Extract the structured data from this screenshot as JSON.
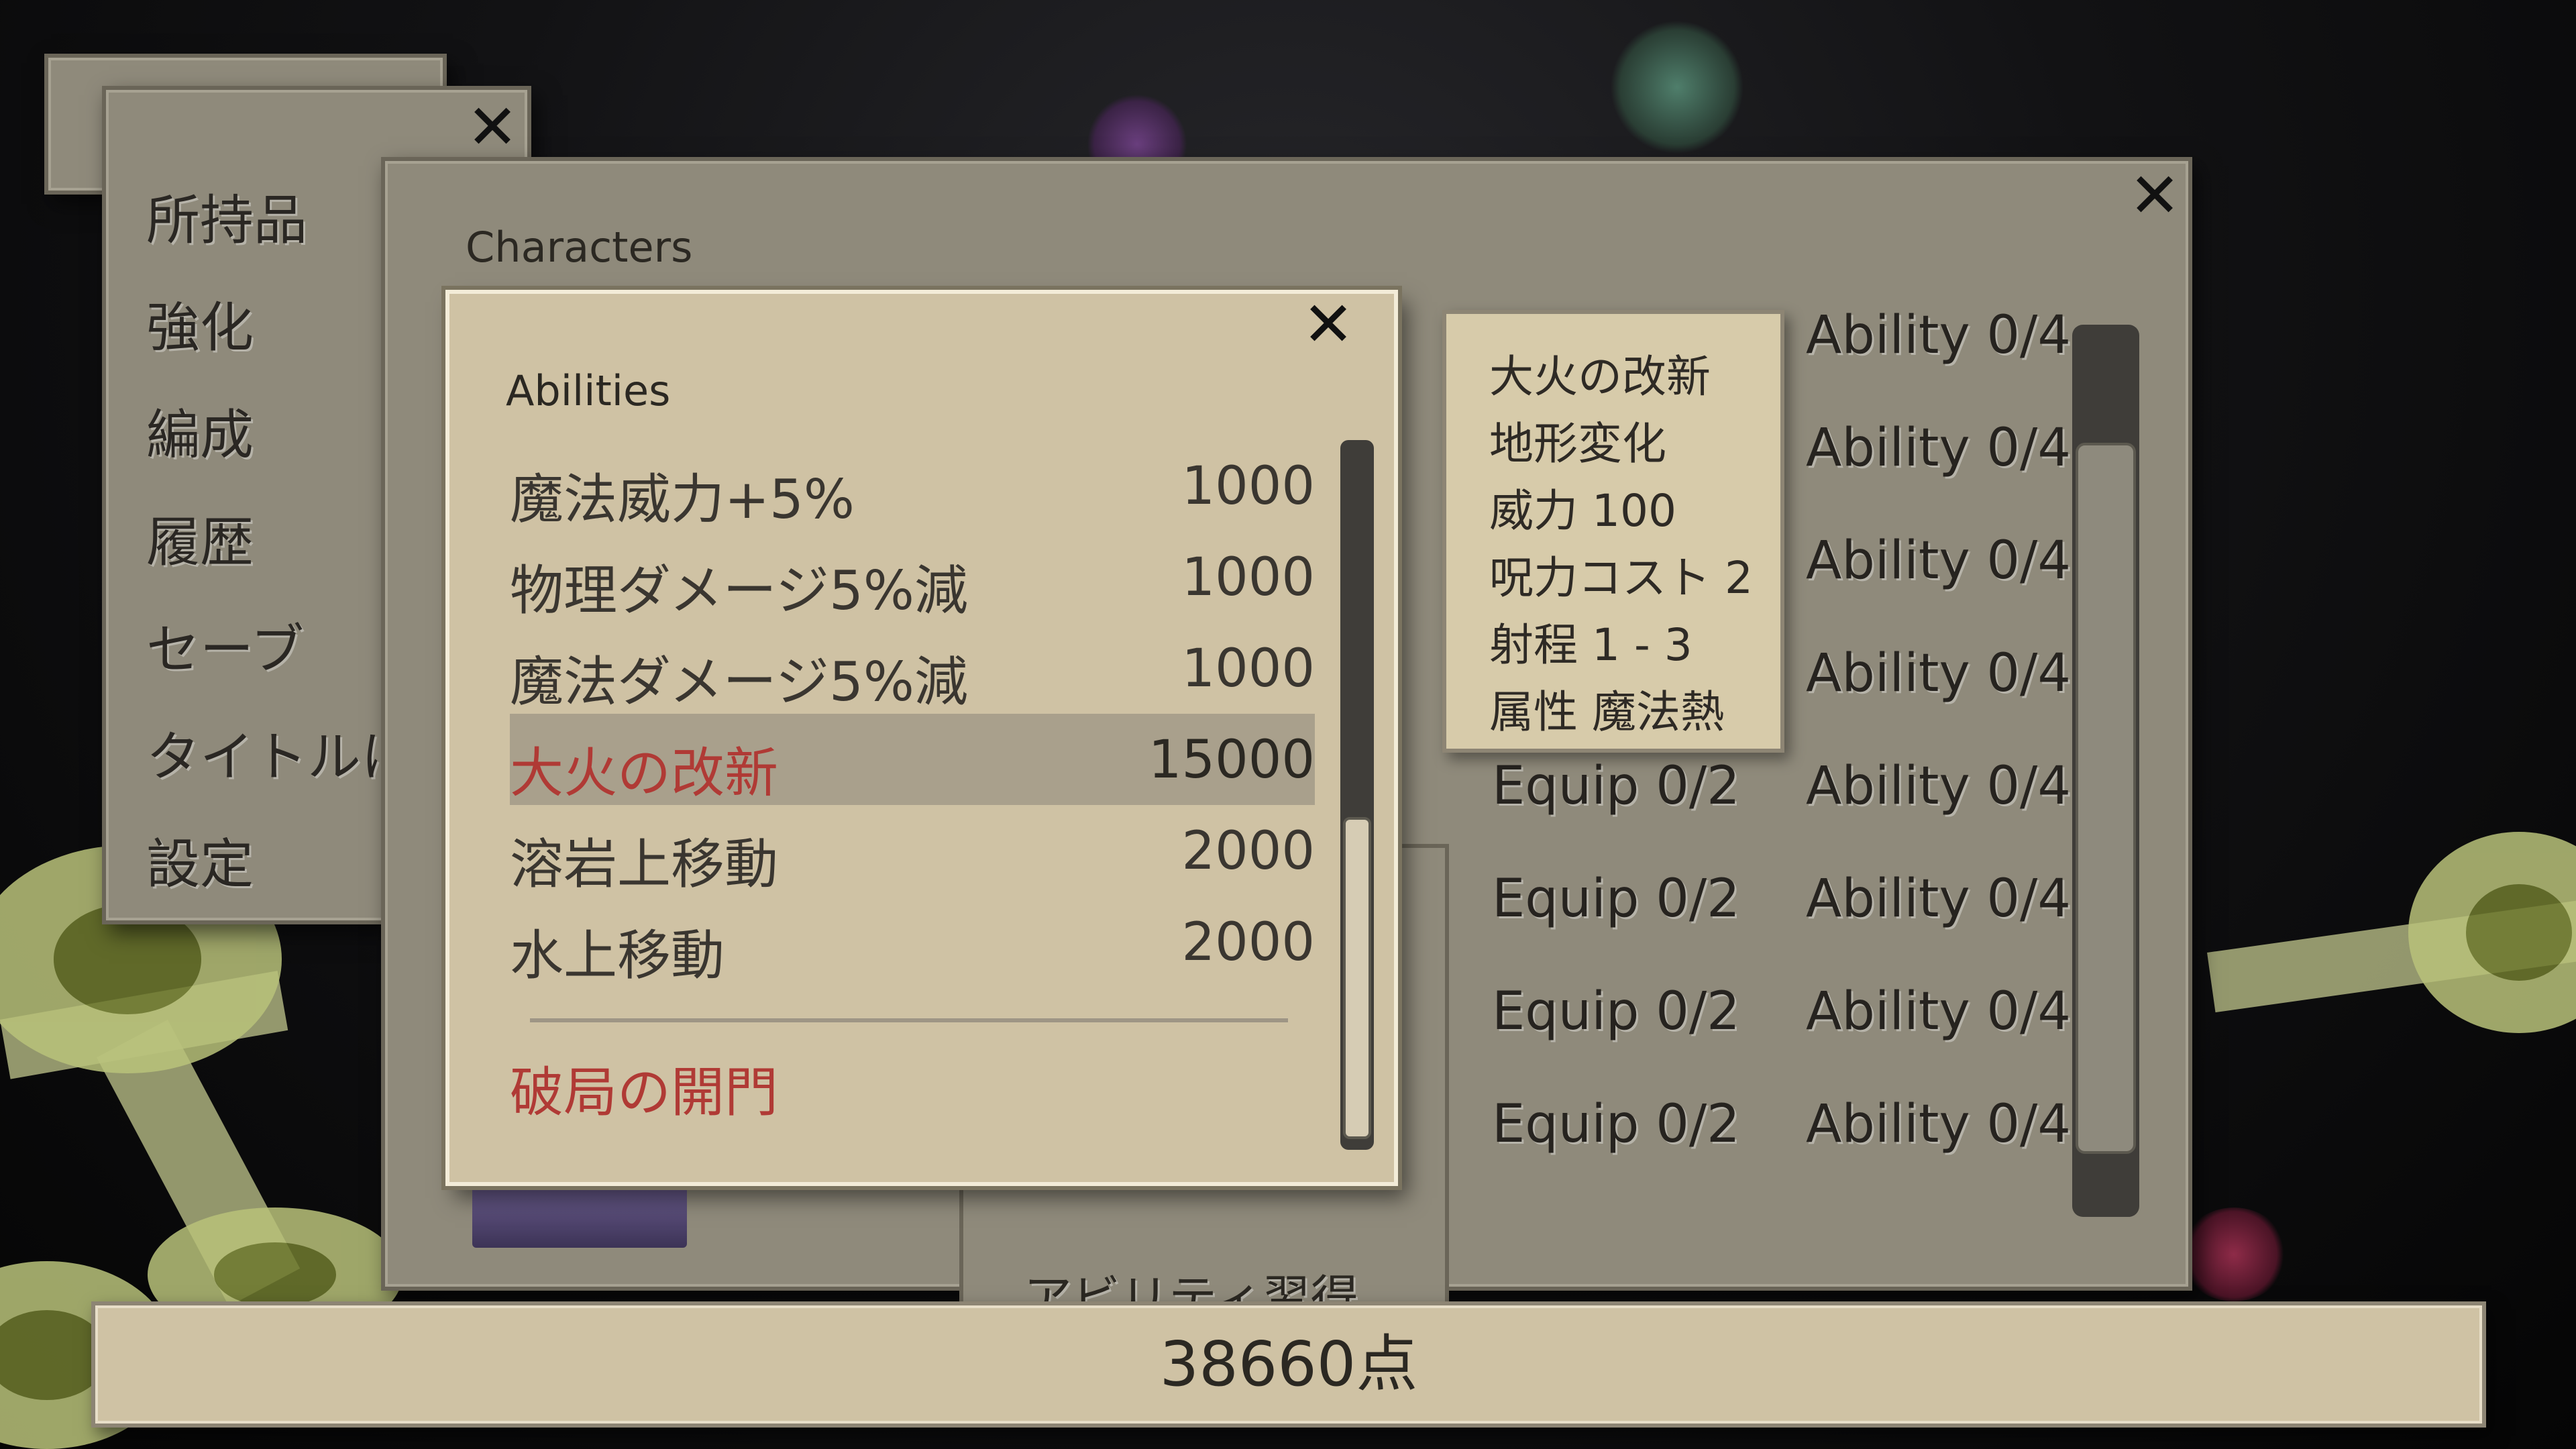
{
  "menu": {
    "items": [
      {
        "label": "所持品"
      },
      {
        "label": "強化"
      },
      {
        "label": "編成"
      },
      {
        "label": "履歴"
      },
      {
        "label": "セーブ"
      },
      {
        "label": "タイトルに"
      },
      {
        "label": "設定"
      }
    ]
  },
  "characters": {
    "title": "Characters",
    "rows": [
      {
        "equip": "",
        "ability": "Ability 0/4"
      },
      {
        "equip": "",
        "ability": "Ability 0/4"
      },
      {
        "equip": "",
        "ability": "Ability 0/4"
      },
      {
        "equip": "",
        "ability": "Ability 0/4"
      },
      {
        "equip": "Equip 0/2",
        "ability": "Ability 0/4"
      },
      {
        "equip": "Equip 0/2",
        "ability": "Ability 0/4"
      },
      {
        "equip": "Equip 0/2",
        "ability": "Ability 0/4"
      },
      {
        "equip": "Equip 0/2",
        "ability": "Ability 0/4"
      }
    ],
    "submenu": {
      "items": [
        "アビリティ習得"
      ]
    }
  },
  "abilities": {
    "title": "Abilities",
    "items": [
      {
        "name": "魔法威力+5%",
        "cost": "1000"
      },
      {
        "name": "物理ダメージ5%減",
        "cost": "1000"
      },
      {
        "name": "魔法ダメージ5%減",
        "cost": "1000"
      },
      {
        "name": "大火の改新",
        "cost": "15000",
        "selected": true
      },
      {
        "name": "溶岩上移動",
        "cost": "2000"
      },
      {
        "name": "水上移動",
        "cost": "2000"
      }
    ],
    "special": "破局の開門"
  },
  "tooltip": {
    "lines": [
      "大火の改新",
      "地形変化",
      "威力 100",
      "呪力コスト 2",
      "射程 1 - 3",
      "属性 魔法熱"
    ]
  },
  "points": {
    "label": "38660点"
  },
  "icons": {
    "close": "close-icon"
  },
  "colors": {
    "selected_text": "#b03a35",
    "special_text": "#b03a35",
    "panel": "#8f8a7b",
    "dialog": "#cfc2a4"
  }
}
